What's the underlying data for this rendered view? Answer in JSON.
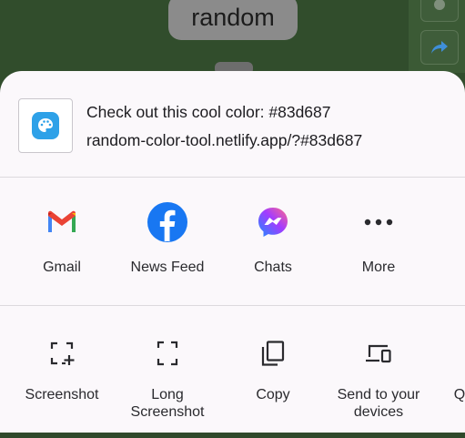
{
  "background": {
    "title": "random"
  },
  "share": {
    "title": "Check out this cool color: #83d687",
    "url": "random-color-tool.netlify.app/?#83d687"
  },
  "targets": [
    {
      "label": "Gmail",
      "icon": "gmail-icon"
    },
    {
      "label": "News Feed",
      "icon": "facebook-icon"
    },
    {
      "label": "Chats",
      "icon": "messenger-icon"
    },
    {
      "label": "More",
      "icon": "more-dots-icon"
    }
  ],
  "actions": [
    {
      "label": "Screenshot",
      "icon": "screenshot-icon"
    },
    {
      "label": "Long\nScreenshot",
      "icon": "long-screenshot-icon"
    },
    {
      "label": "Copy",
      "icon": "copy-icon"
    },
    {
      "label": "Send to your\ndevices",
      "icon": "send-to-devices-icon"
    },
    {
      "label": "Q",
      "icon": "partial-item"
    }
  ],
  "colors": {
    "facebook": "#1877f2",
    "gmail_red": "#ea4335",
    "messenger_start": "#1e8cff",
    "messenger_end": "#ff5e9e",
    "app_icon": "#2ea1e8"
  }
}
